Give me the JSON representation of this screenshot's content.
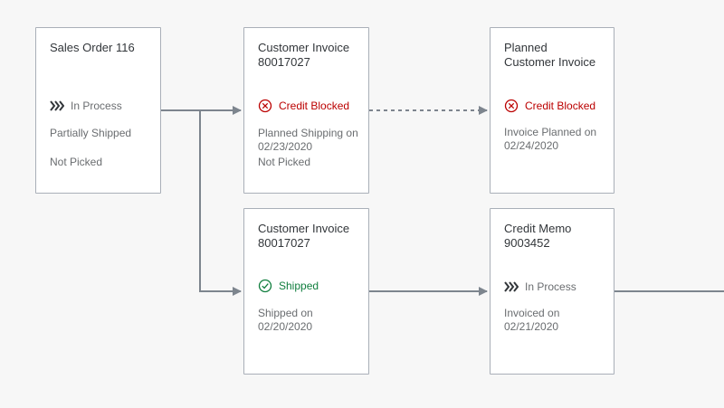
{
  "colors": {
    "background": "#f7f7f7",
    "node_border": "#a9afb8",
    "connector": "#7d858e",
    "error": "#bb0000",
    "success": "#107e3e",
    "neutral": "#6a6d70"
  },
  "nodes": {
    "sales_order": {
      "title": "Sales Order 116",
      "status": "In Process",
      "status_icon": "in-process-chevrons-icon",
      "detail_1": "Partially Shipped",
      "detail_2": "Not Picked"
    },
    "invoice_blocked": {
      "title": "Customer Invoice\n80017027",
      "status": "Credit Blocked",
      "status_icon": "error-circle-icon",
      "detail_1": "Planned Shipping on\n02/23/2020",
      "detail_2": "Not Picked"
    },
    "planned_invoice": {
      "title": "Planned\nCustomer Invoice",
      "status": "Credit Blocked",
      "status_icon": "error-circle-icon",
      "detail_1": "Invoice Planned on\n02/24/2020"
    },
    "invoice_shipped": {
      "title": "Customer Invoice\n80017027",
      "status": "Shipped",
      "status_icon": "success-check-icon",
      "detail_1": "Shipped on\n02/20/2020"
    },
    "credit_memo": {
      "title": "Credit Memo\n9003452",
      "status": "In Process",
      "status_icon": "in-process-chevrons-icon",
      "detail_1": "Invoiced on\n02/21/2020"
    }
  }
}
